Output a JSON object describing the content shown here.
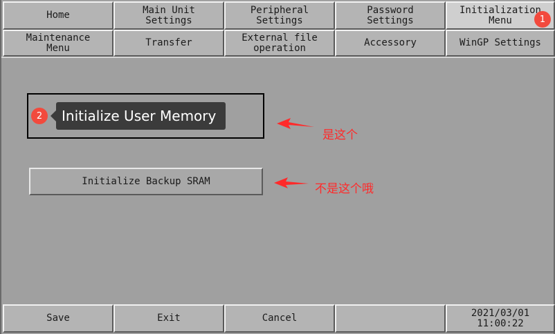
{
  "tabs_row1": [
    {
      "id": "home",
      "label": "Home"
    },
    {
      "id": "main-unit-settings",
      "label": "Main Unit\nSettings"
    },
    {
      "id": "peripheral-settings",
      "label": "Peripheral\nSettings"
    },
    {
      "id": "password-settings",
      "label": "Password\nSettings"
    },
    {
      "id": "initialization-menu",
      "label": "Initialization\nMenu"
    }
  ],
  "tabs_row2": [
    {
      "id": "maintenance-menu",
      "label": "Maintenance\nMenu"
    },
    {
      "id": "transfer",
      "label": "Transfer"
    },
    {
      "id": "external-file-operation",
      "label": "External file\noperation"
    },
    {
      "id": "accessory",
      "label": "Accessory"
    },
    {
      "id": "wingp-settings",
      "label": "WinGP Settings"
    }
  ],
  "content": {
    "tooltip_label": "Initialize User Memory",
    "backup_sram_label": "Initialize Backup SRAM"
  },
  "annotations": {
    "badge1": "1",
    "badge2": "2",
    "note1": "是这个",
    "note2": "不是这个哦",
    "color": "#ff2a2a"
  },
  "footer": {
    "save_label": "Save",
    "exit_label": "Exit",
    "cancel_label": "Cancel",
    "date": "2021/03/01",
    "time": "11:00:22"
  }
}
